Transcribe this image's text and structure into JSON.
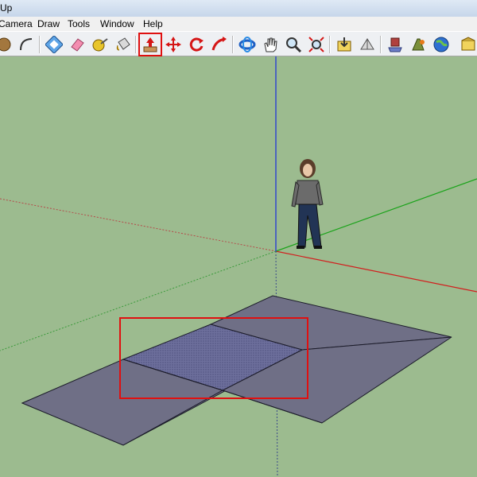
{
  "window": {
    "title_fragment": "Up"
  },
  "menu": {
    "items": [
      "Camera",
      "Draw",
      "Tools",
      "Window",
      "Help"
    ]
  },
  "toolbar": {
    "tools": [
      {
        "name": "circle-icon"
      },
      {
        "name": "arc-icon"
      },
      {
        "name": "offset-icon"
      },
      {
        "name": "eraser-icon"
      },
      {
        "name": "tape-measure-icon"
      },
      {
        "name": "paint-bucket-icon"
      },
      {
        "name": "push-pull-icon",
        "selected": true
      },
      {
        "name": "move-icon"
      },
      {
        "name": "rotate-icon"
      },
      {
        "name": "follow-me-icon"
      },
      {
        "name": "orbit-icon"
      },
      {
        "name": "pan-icon"
      },
      {
        "name": "zoom-icon"
      },
      {
        "name": "zoom-extents-icon"
      },
      {
        "name": "get-models-icon"
      },
      {
        "name": "share-model-icon"
      },
      {
        "name": "components-icon"
      },
      {
        "name": "extension-icon"
      },
      {
        "name": "google-earth-icon"
      },
      {
        "name": "warehouse-icon"
      }
    ]
  },
  "colors": {
    "ground": "#9cbb8f",
    "face": "#6f6f86",
    "selected_face": "#6d6f9c",
    "red_axis": "#d21e1e",
    "green_axis": "#1aa31a",
    "blue_axis": "#2b3fd2",
    "highlight": "#e01010"
  }
}
